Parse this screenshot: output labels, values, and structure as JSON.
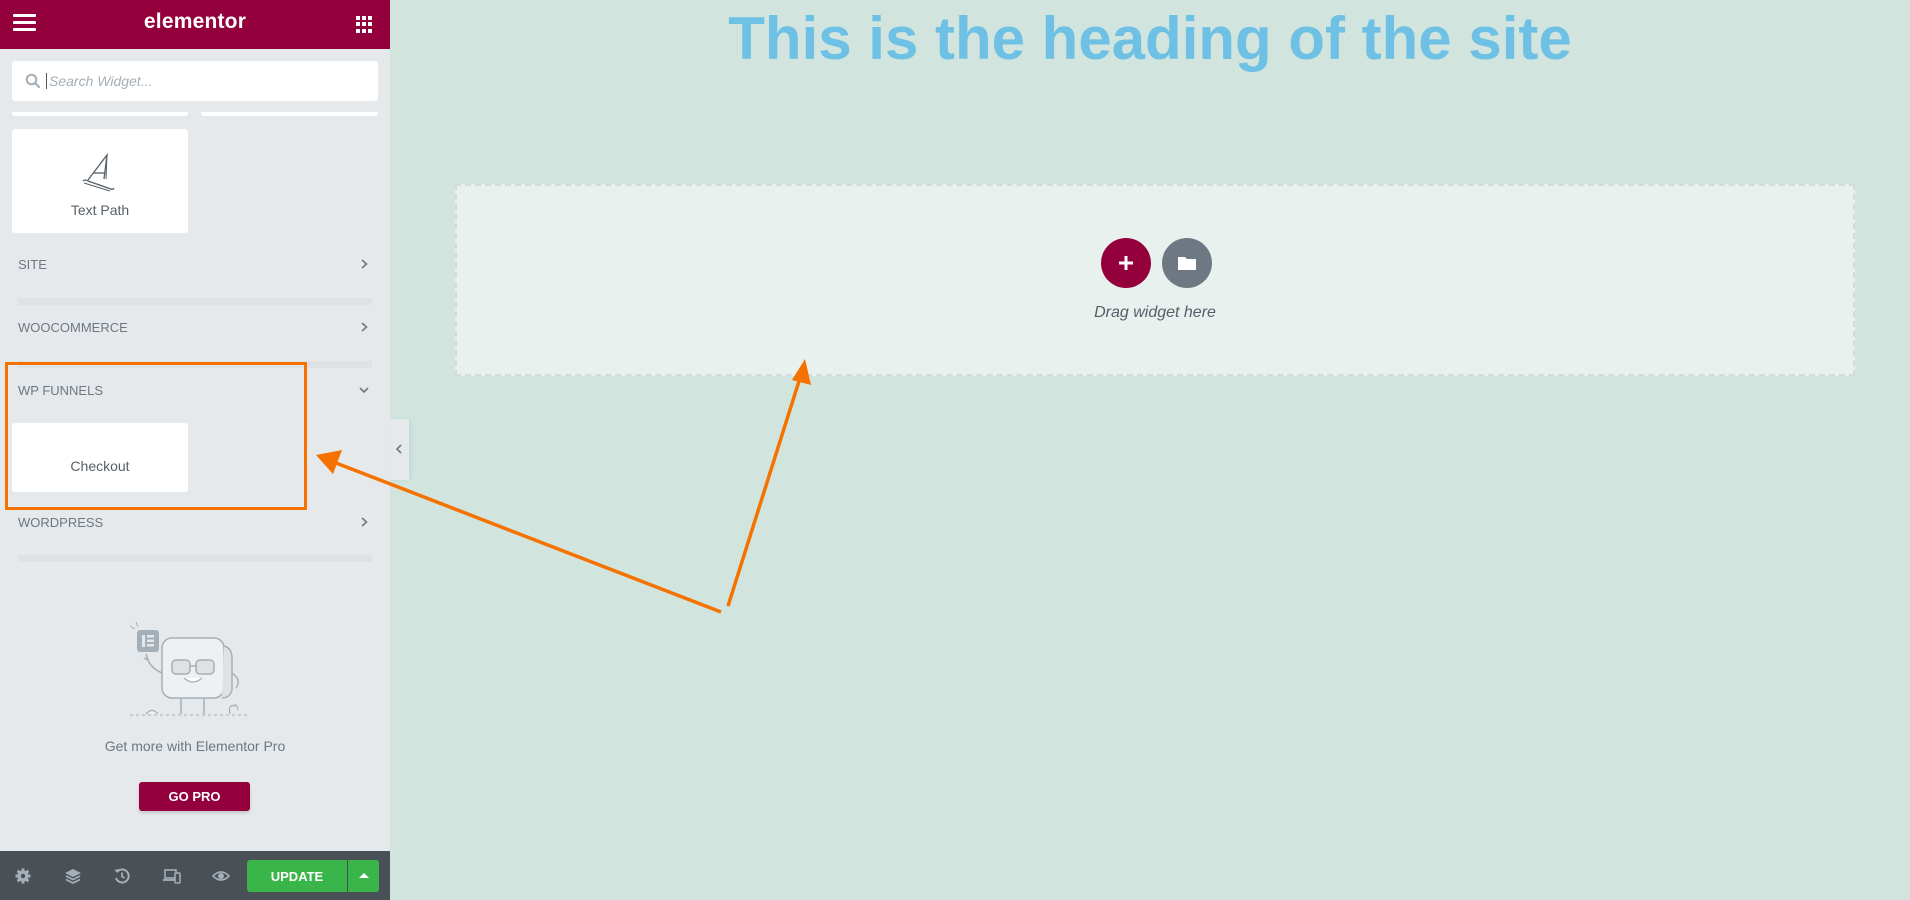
{
  "header": {
    "logo_text": "elementor",
    "menu_icon": "hamburger-icon",
    "widgets_icon": "grid-icon"
  },
  "search": {
    "placeholder": "Search Widget...",
    "value": "",
    "icon": "search-icon"
  },
  "widgets": {
    "text_path": {
      "label": "Text Path",
      "icon": "text-path-icon"
    },
    "checkout": {
      "label": "Checkout"
    }
  },
  "categories": [
    {
      "title": "SITE",
      "state": "collapsed"
    },
    {
      "title": "WOOCOMMERCE",
      "state": "collapsed"
    },
    {
      "title": "WP FUNNELS",
      "state": "expanded"
    },
    {
      "title": "WORDPRESS",
      "state": "collapsed"
    }
  ],
  "promo": {
    "text": "Get more with Elementor Pro",
    "button_label": "GO PRO"
  },
  "footer": {
    "icons": [
      "settings-icon",
      "navigator-layers-icon",
      "history-icon",
      "responsive-mode-icon",
      "preview-eye-icon"
    ],
    "update_label": "UPDATE"
  },
  "canvas": {
    "heading": "This is the heading of the site",
    "drop_text": "Drag widget here"
  },
  "colors": {
    "brand": "#93003c",
    "update_green": "#39b54a",
    "heading_blue": "#6ec1e4",
    "annotation_orange": "#f57200",
    "canvas_bg": "#d1e4de"
  }
}
